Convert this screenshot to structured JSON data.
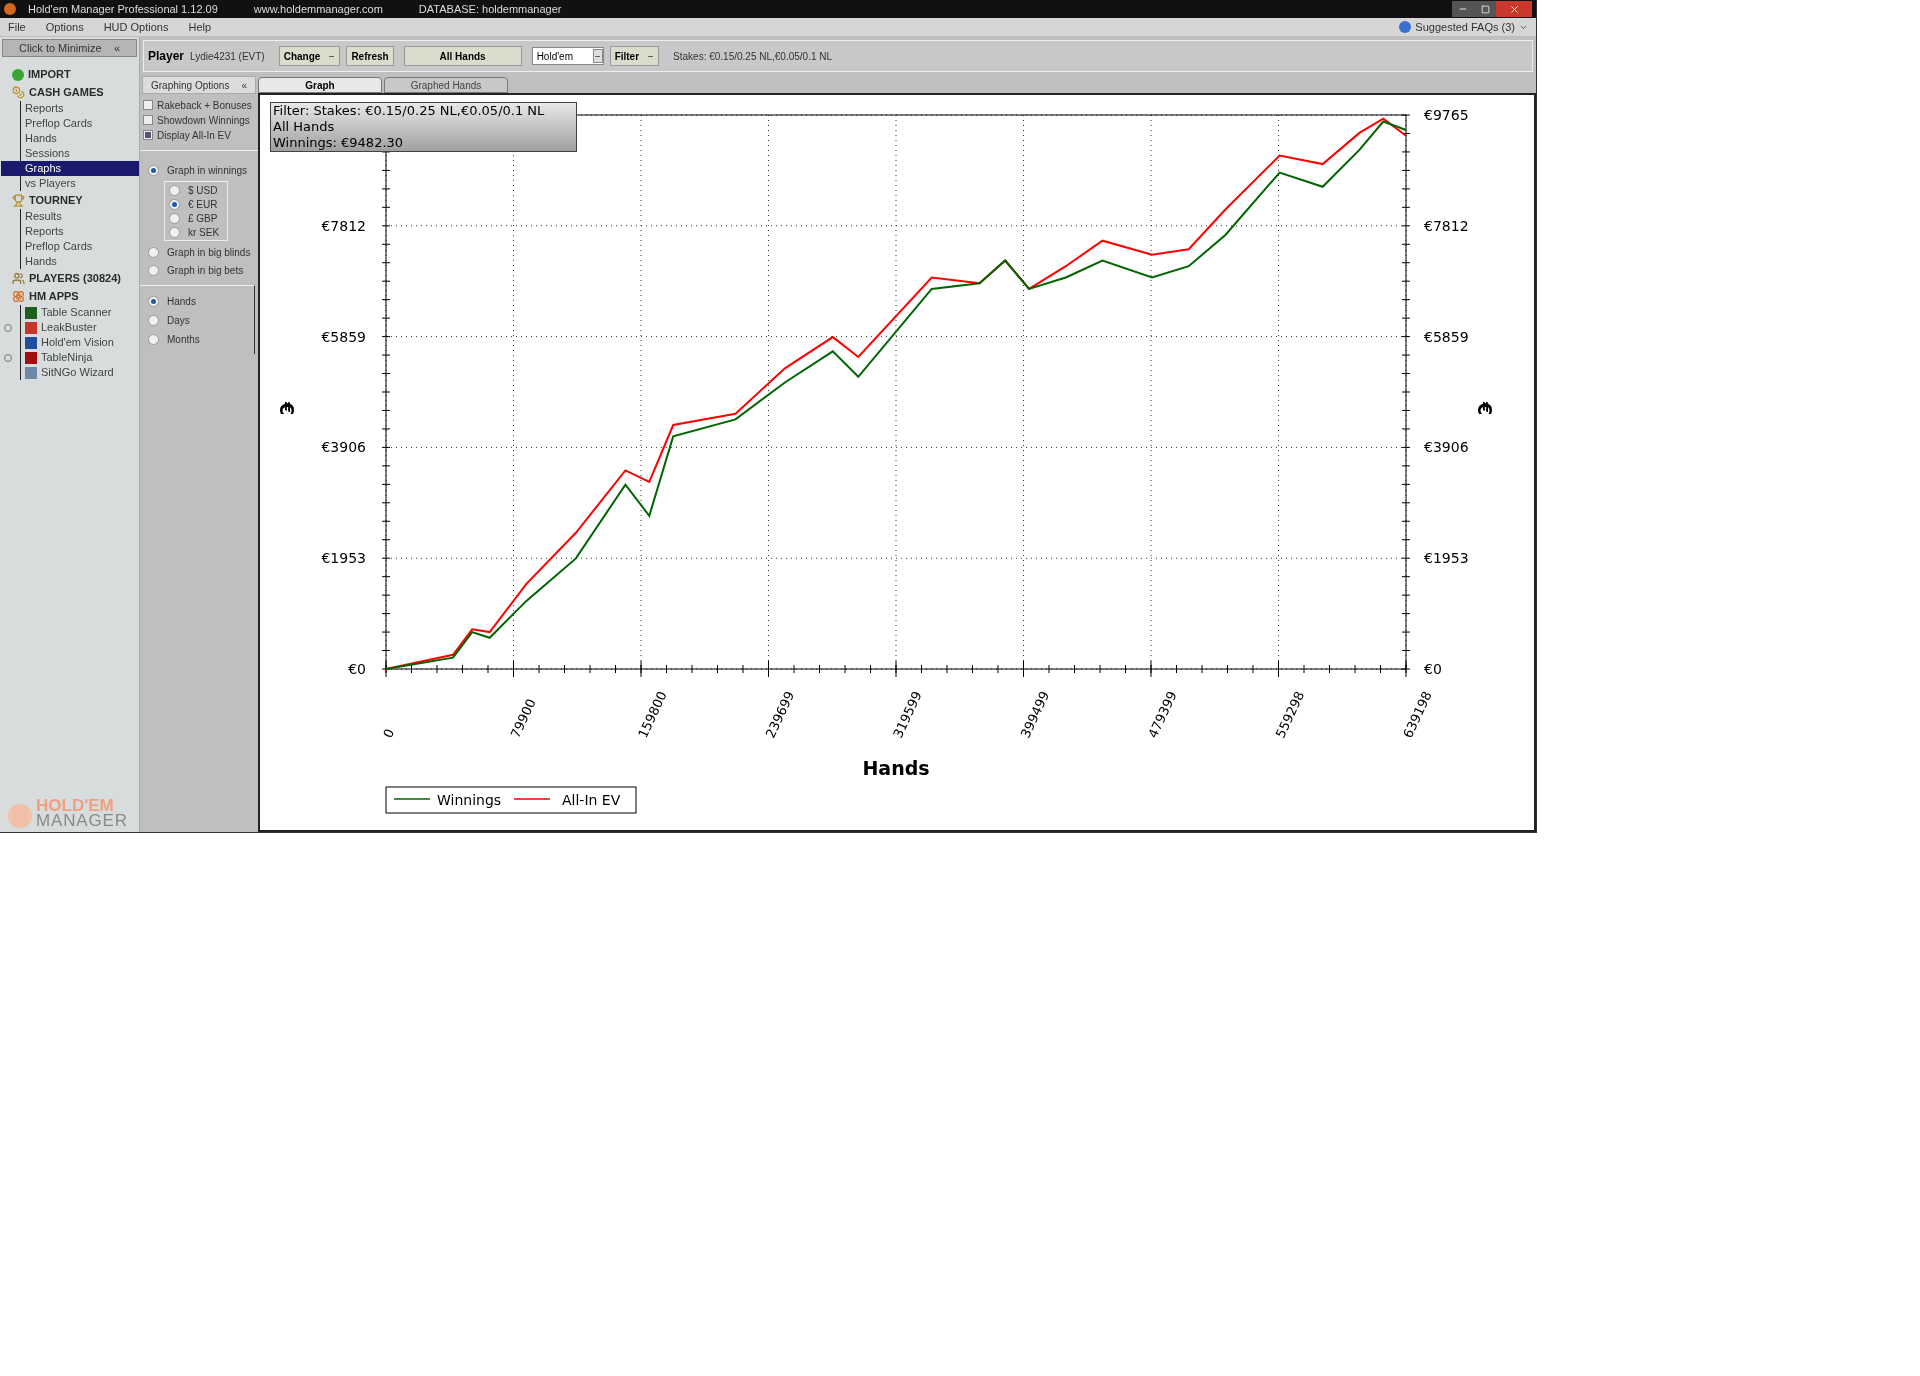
{
  "window": {
    "title": "Hold'em Manager Professional 1.12.09",
    "website": "www.holdemmanager.com",
    "database": "DATABASE: holdemmanager"
  },
  "menu": {
    "items": [
      "File",
      "Options",
      "HUD Options",
      "Help"
    ],
    "faq": "Suggested FAQs (3)"
  },
  "sidebar": {
    "minimize": "Click to Minimize",
    "minimize_icon": "«",
    "sections": [
      {
        "label": "IMPORT",
        "kind": "import"
      },
      {
        "label": "CASH GAMES",
        "kind": "cash",
        "children": [
          {
            "label": "Reports",
            "selected": false
          },
          {
            "label": "Preflop Cards",
            "selected": false
          },
          {
            "label": "Hands",
            "selected": false
          },
          {
            "label": "Sessions",
            "selected": false
          },
          {
            "label": "Graphs",
            "selected": true
          },
          {
            "label": "vs Players",
            "selected": false
          }
        ]
      },
      {
        "label": "TOURNEY",
        "kind": "tourney",
        "children": [
          {
            "label": "Results",
            "selected": false
          },
          {
            "label": "Reports",
            "selected": false
          },
          {
            "label": "Preflop Cards",
            "selected": false
          },
          {
            "label": "Hands",
            "selected": false
          }
        ]
      },
      {
        "label": "PLAYERS (30824)",
        "kind": "players"
      },
      {
        "label": "HM APPS",
        "kind": "apps",
        "children": [
          {
            "label": "Table Scanner",
            "selected": false,
            "kind": "scanner"
          },
          {
            "label": "LeakBuster",
            "selected": false,
            "kind": "leakbuster"
          },
          {
            "label": "Hold'em Vision",
            "selected": false,
            "kind": "vision"
          },
          {
            "label": "TableNinja",
            "selected": false,
            "kind": "ninja"
          },
          {
            "label": "SitNGo Wizard",
            "selected": false,
            "kind": "wizard"
          }
        ]
      }
    ],
    "logo": [
      "HOLD'EM",
      "MANAGER"
    ]
  },
  "toolbar": {
    "player_label": "Player",
    "player": "Lydie4231 (EVT)",
    "controls": [
      {
        "kind": "button",
        "label": "Change",
        "dropdown": true
      },
      {
        "kind": "button",
        "label": "Refresh",
        "dropdown": false
      },
      {
        "kind": "wide",
        "label": "All Hands",
        "dropdown": false
      },
      {
        "kind": "select",
        "label": "Hold'em",
        "dropdown": true
      },
      {
        "kind": "button",
        "label": "Filter",
        "dropdown": true
      }
    ],
    "stakes": "Stakes: €0.15/0.25 NL,€0.05/0.1 NL"
  },
  "options": {
    "title": "Graphing Options",
    "collapse_icon": "«",
    "checkboxes": [
      {
        "label": "Rakeback + Bonuses",
        "checked": false
      },
      {
        "label": "Showdown Winnings",
        "checked": false
      },
      {
        "label": "Display All-In EV",
        "checked": true
      }
    ],
    "units": [
      {
        "label": "Graph in winnings",
        "selected": true,
        "currencies": [
          {
            "label": "$ USD",
            "selected": false
          },
          {
            "label": "€ EUR",
            "selected": true
          },
          {
            "label": "£ GBP",
            "selected": false
          },
          {
            "label": "kr SEK",
            "selected": false
          }
        ]
      },
      {
        "label": "Graph in big blinds",
        "selected": false
      },
      {
        "label": "Graph in big bets",
        "selected": false
      }
    ],
    "periods": [
      {
        "label": "Hands",
        "selected": true
      },
      {
        "label": "Days",
        "selected": false
      },
      {
        "label": "Months",
        "selected": false
      }
    ]
  },
  "tabs": [
    {
      "label": "Graph",
      "selected": true
    },
    {
      "label": "Graphed Hands",
      "selected": false
    }
  ],
  "graph": {
    "info": [
      "Filter: Stakes: €0.15/0.25 NL,€0.05/0.1 NL",
      "All Hands",
      "Winnings: €9482.30"
    ],
    "chart_data": {
      "type": "line",
      "xlabel": "Hands",
      "ylabel": "€",
      "grid": true,
      "legend": true,
      "x": [
        0,
        42000,
        54000,
        65000,
        88000,
        119000,
        150000,
        165000,
        180000,
        219000,
        250000,
        280000,
        296000,
        342000,
        372000,
        388000,
        403000,
        426000,
        449000,
        480000,
        503000,
        526000,
        560000,
        587000,
        610000,
        625000,
        639198
      ],
      "series": [
        {
          "name": "Winnings",
          "color": "#006400",
          "values": [
            0,
            200,
            650,
            550,
            1200,
            1950,
            3250,
            2700,
            4100,
            4400,
            5050,
            5600,
            5150,
            6700,
            6800,
            7200,
            6700,
            6900,
            7200,
            6900,
            7100,
            7650,
            8750,
            8500,
            9150,
            9650,
            9500
          ]
        },
        {
          "name": "All-In EV",
          "color": "#ff0000",
          "values": [
            0,
            250,
            700,
            650,
            1500,
            2400,
            3500,
            3300,
            4300,
            4500,
            5300,
            5850,
            5500,
            6900,
            6800,
            7200,
            6700,
            7100,
            7550,
            7300,
            7400,
            8100,
            9050,
            8900,
            9450,
            9700,
            9400
          ]
        }
      ],
      "xlim": [
        0,
        639198
      ],
      "ylim": [
        0,
        9765
      ],
      "xticks": [
        0,
        79900,
        159800,
        239699,
        319599,
        399499,
        479399,
        559298,
        639198
      ],
      "yticks": [
        {
          "value": 0,
          "label": "€0"
        },
        {
          "value": 1953,
          "label": "€1953"
        },
        {
          "value": 3906,
          "label": "€3906"
        },
        {
          "value": 5859,
          "label": "€5859"
        },
        {
          "value": 7812,
          "label": "€7812"
        },
        {
          "value": 9765,
          "label": "€9765"
        }
      ]
    }
  }
}
